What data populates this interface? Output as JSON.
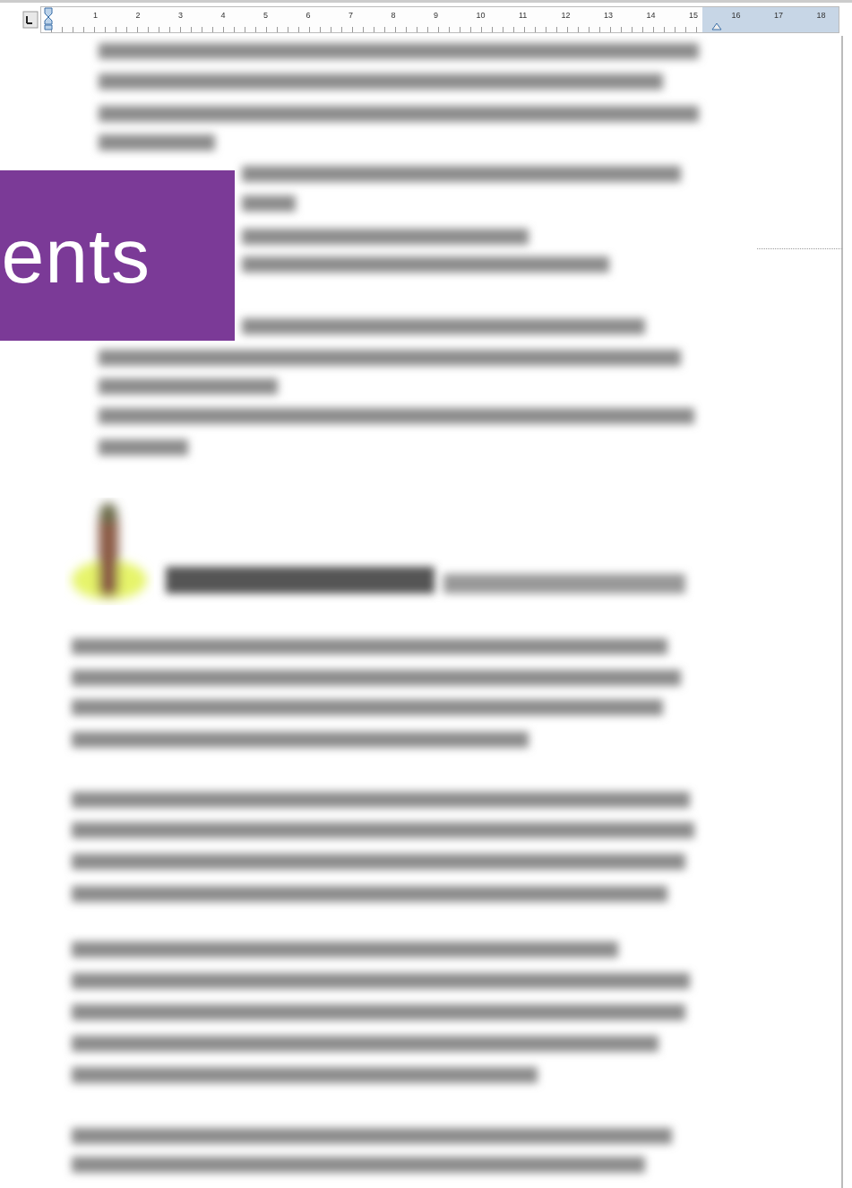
{
  "ruler": {
    "numbers": [
      "1",
      "2",
      "3",
      "4",
      "5",
      "6",
      "7",
      "8",
      "9",
      "10",
      "11",
      "12",
      "13",
      "14",
      "15",
      "16",
      "17",
      "18"
    ]
  },
  "banner": {
    "text": "ents"
  }
}
